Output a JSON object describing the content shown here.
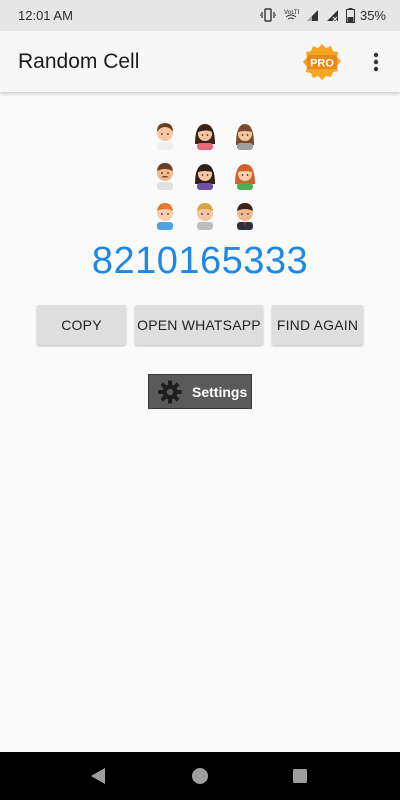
{
  "status_bar": {
    "time": "12:01 AM",
    "battery_percent": "35%",
    "icons": [
      "vibrate-icon",
      "volte-icon",
      "signal-1-icon",
      "signal-2-icon",
      "battery-icon"
    ]
  },
  "app_bar": {
    "title": "Random Cell",
    "pro_badge": "PRO",
    "menu_icon": "more-vert-icon"
  },
  "avatars": [
    "man-brown-hair",
    "woman-dark-hair",
    "woman-brown-hair",
    "man-mustache",
    "woman-dark-hair-2",
    "woman-red-hair",
    "boy-ginger",
    "man-blond",
    "man-dark-suit"
  ],
  "phone_number": "8210165333",
  "buttons": {
    "copy": "COPY",
    "open_whatsapp": "OPEN WHATSAPP",
    "find_again": "FIND AGAIN"
  },
  "settings": {
    "label": "Settings",
    "icon": "gear-icon"
  },
  "nav_bar": [
    "back-icon",
    "home-icon",
    "recents-icon"
  ],
  "colors": {
    "accent": "#1e88e5",
    "settings_bg": "#5a5a5a",
    "pro_badge": "#f5a623"
  }
}
